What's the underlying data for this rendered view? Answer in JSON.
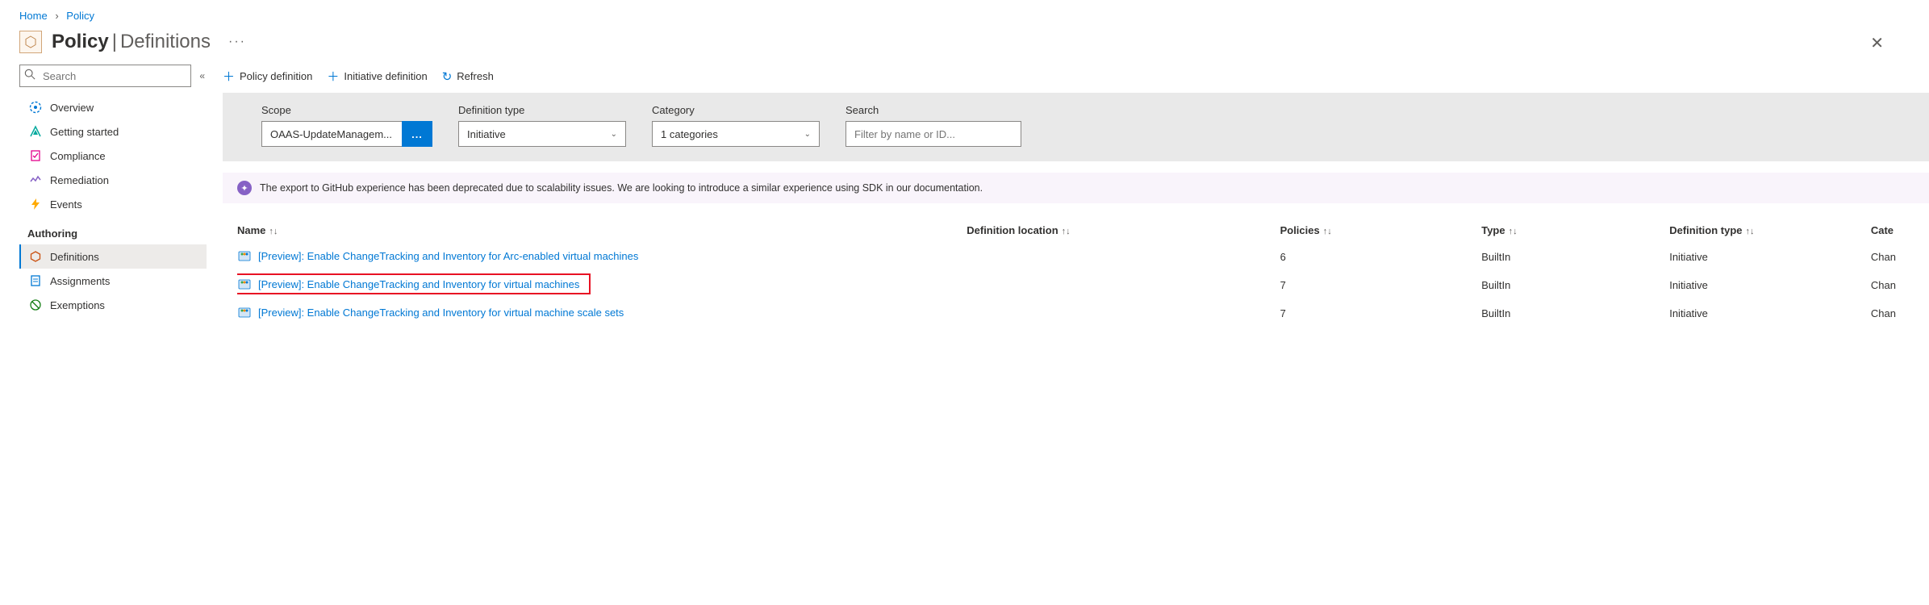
{
  "breadcrumb": {
    "home": "Home",
    "policy": "Policy"
  },
  "header": {
    "title": "Policy",
    "subtitle": "Definitions"
  },
  "sidebar": {
    "search_placeholder": "Search",
    "items": [
      {
        "label": "Overview"
      },
      {
        "label": "Getting started"
      },
      {
        "label": "Compliance"
      },
      {
        "label": "Remediation"
      },
      {
        "label": "Events"
      }
    ],
    "authoring_label": "Authoring",
    "authoring": [
      {
        "label": "Definitions"
      },
      {
        "label": "Assignments"
      },
      {
        "label": "Exemptions"
      }
    ]
  },
  "commands": {
    "policy_def": "Policy definition",
    "initiative_def": "Initiative definition",
    "refresh": "Refresh"
  },
  "filters": {
    "scope_label": "Scope",
    "scope_value": "OAAS-UpdateManagem...",
    "deftype_label": "Definition type",
    "deftype_value": "Initiative",
    "category_label": "Category",
    "category_value": "1 categories",
    "search_label": "Search",
    "search_placeholder": "Filter by name or ID..."
  },
  "banner": "The export to GitHub experience has been deprecated due to scalability issues. We are looking to introduce a similar experience using SDK in our documentation.",
  "table": {
    "cols": {
      "name": "Name",
      "loc": "Definition location",
      "policies": "Policies",
      "type": "Type",
      "deftype": "Definition type",
      "category": "Cate"
    },
    "rows": [
      {
        "name": "[Preview]: Enable ChangeTracking and Inventory for Arc-enabled virtual machines",
        "policies": "6",
        "type": "BuiltIn",
        "deftype": "Initiative",
        "category": "Chan",
        "hl": false
      },
      {
        "name": "[Preview]: Enable ChangeTracking and Inventory for virtual machines",
        "policies": "7",
        "type": "BuiltIn",
        "deftype": "Initiative",
        "category": "Chan",
        "hl": true
      },
      {
        "name": "[Preview]: Enable ChangeTracking and Inventory for virtual machine scale sets",
        "policies": "7",
        "type": "BuiltIn",
        "deftype": "Initiative",
        "category": "Chan",
        "hl": false
      }
    ]
  }
}
